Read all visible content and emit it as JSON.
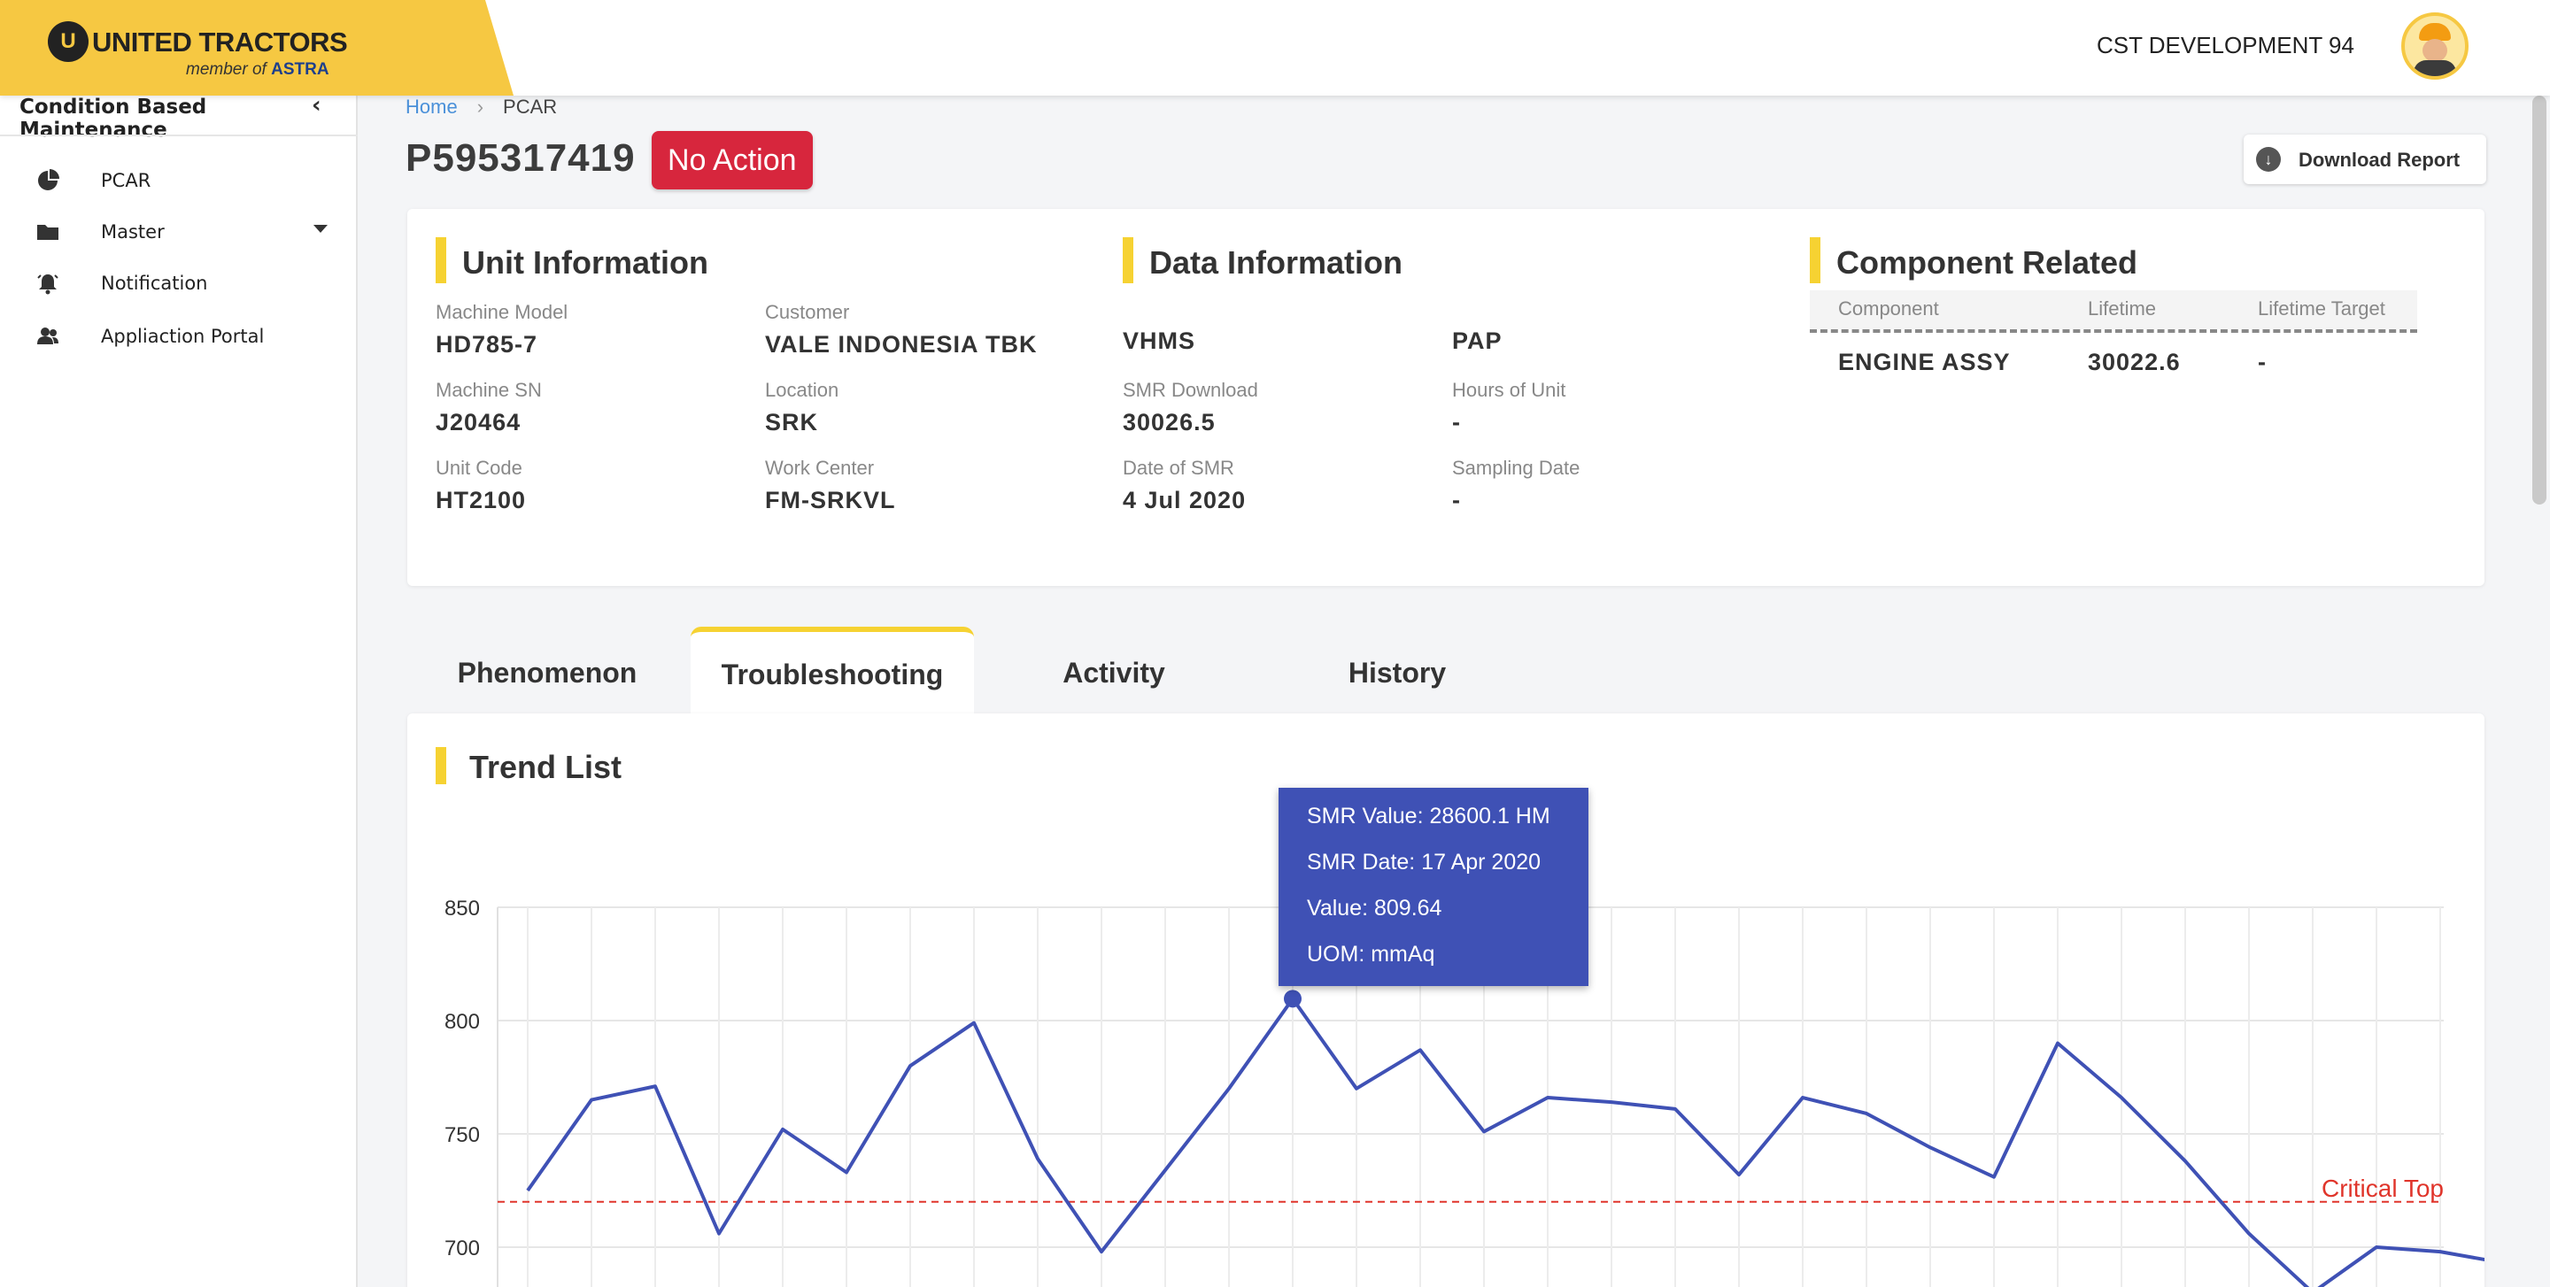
{
  "header": {
    "brand_name": "UNITED TRACTORS",
    "brand_sub_prefix": "member of",
    "brand_sub_group": "ASTRA",
    "user_name": "CST DEVELOPMENT 94"
  },
  "sidebar": {
    "title": "Condition Based Maintenance",
    "items": [
      {
        "label": "PCAR",
        "icon": "pie-chart-icon"
      },
      {
        "label": "Master",
        "icon": "folder-icon"
      },
      {
        "label": "Notification",
        "icon": "alarm-bell-icon"
      },
      {
        "label": "Appliaction Portal",
        "icon": "users-icon"
      }
    ]
  },
  "breadcrumb": {
    "home": "Home",
    "current": "PCAR"
  },
  "page": {
    "title": "P595317419",
    "status": "No Action",
    "download_label": "Download Report"
  },
  "unit_info": {
    "heading": "Unit Information",
    "fields": [
      {
        "label": "Machine Model",
        "value": "HD785-7"
      },
      {
        "label": "Customer",
        "value": "VALE INDONESIA TBK"
      },
      {
        "label": "Machine SN",
        "value": "J20464"
      },
      {
        "label": "Location",
        "value": "SRK"
      },
      {
        "label": "Unit Code",
        "value": "HT2100"
      },
      {
        "label": "Work Center",
        "value": "FM-SRKVL"
      }
    ]
  },
  "data_info": {
    "heading": "Data Information",
    "fields": [
      {
        "label": "",
        "value": "VHMS"
      },
      {
        "label": "",
        "value": "PAP"
      },
      {
        "label": "SMR Download",
        "value": "30026.5"
      },
      {
        "label": "Hours of Unit",
        "value": "-"
      },
      {
        "label": "Date of SMR",
        "value": "4 Jul 2020"
      },
      {
        "label": "Sampling Date",
        "value": "-"
      }
    ]
  },
  "component": {
    "heading": "Component Related",
    "columns": [
      "Component",
      "Lifetime",
      "Lifetime Target"
    ],
    "rows": [
      [
        "ENGINE ASSY",
        "30022.6",
        "-"
      ]
    ]
  },
  "tabs": [
    "Phenomenon",
    "Troubleshooting",
    "Activity",
    "History"
  ],
  "active_tab": "Troubleshooting",
  "trend": {
    "heading": "Trend List",
    "tooltip": {
      "smr_value": "SMR Value: 28600.1 HM",
      "smr_date": "SMR Date: 17 Apr 2020",
      "value": "Value: 809.64",
      "uom": "UOM: mmAq"
    }
  },
  "chart_data": {
    "type": "line",
    "y_ticks": [
      850,
      800,
      750,
      700
    ],
    "ylim": [
      670,
      850
    ],
    "x_points": 32,
    "values": [
      725,
      765,
      771,
      706,
      752,
      733,
      780,
      799,
      739,
      698,
      734,
      770,
      809.64,
      770,
      787,
      751,
      766,
      764,
      761,
      732,
      766,
      759,
      744,
      731,
      790,
      766,
      738,
      706,
      680,
      700,
      698,
      693
    ],
    "highlight_index": 12,
    "threshold": {
      "label": "Critical Top",
      "value": 720,
      "color": "#e0352b"
    },
    "line_color": "#3f51b5",
    "grid": true
  }
}
